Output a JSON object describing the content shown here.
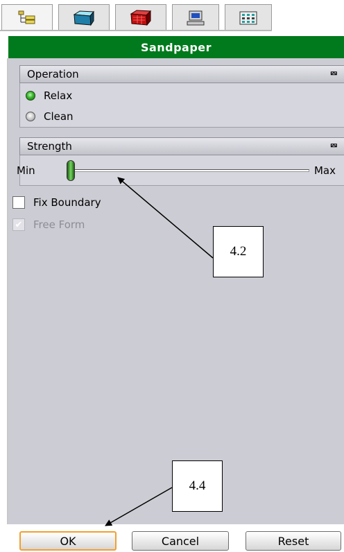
{
  "tabs": [
    {
      "icon": "tree-icon"
    },
    {
      "icon": "cube-icon"
    },
    {
      "icon": "red-box-icon"
    },
    {
      "icon": "computer-icon"
    },
    {
      "icon": "grid-panel-icon"
    }
  ],
  "title": "Sandpaper",
  "operation": {
    "header": "Operation",
    "options": [
      "Relax",
      "Clean"
    ],
    "selected": "Relax"
  },
  "strength": {
    "header": "Strength",
    "min_label": "Min",
    "max_label": "Max",
    "value": 0.0
  },
  "options": {
    "fix_boundary": {
      "label": "Fix Boundary",
      "checked": false
    },
    "free_form": {
      "label": "Free Form",
      "checked": true,
      "enabled": false
    }
  },
  "callouts": {
    "slider": "4.2",
    "ok": "4.4"
  },
  "buttons": {
    "ok": "OK",
    "cancel": "Cancel",
    "reset": "Reset"
  },
  "colors": {
    "title_bar": "#007a1c",
    "panel": "#ccccd4",
    "focus_border": "#f0a030"
  }
}
